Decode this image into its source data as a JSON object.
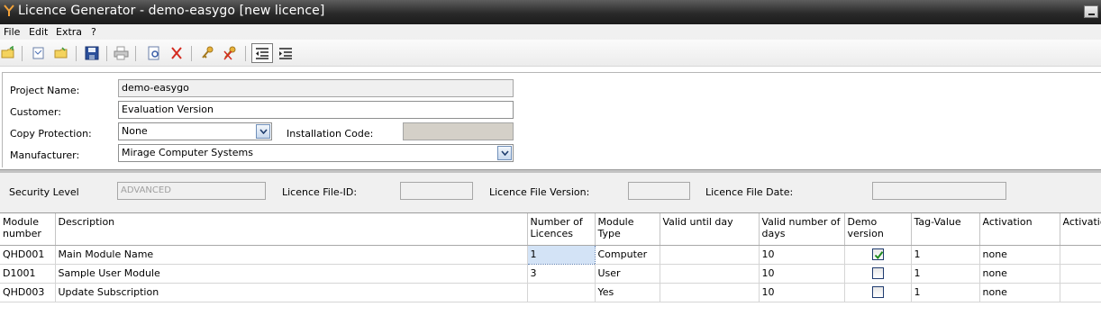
{
  "window": {
    "title": "Licence Generator - demo-easygo [new licence]"
  },
  "menu": [
    "File",
    "Edit",
    "Extra",
    "?"
  ],
  "toolbar": {
    "icons": [
      "open-folder-icon",
      "new-document-icon",
      "open-file-icon",
      "save-icon",
      "print-icon",
      "preview-icon",
      "delete-icon",
      "key-icon",
      "remove-key-icon",
      "indent-icon",
      "outdent-icon"
    ]
  },
  "form": {
    "project_name_label": "Project Name:",
    "project_name": "demo-easygo",
    "customer_label": "Customer:",
    "customer": "Evaluation Version",
    "copy_protection_label": "Copy Protection:",
    "copy_protection": "None",
    "installation_code_label": "Installation Code:",
    "installation_code": "",
    "manufacturer_label": "Manufacturer:",
    "manufacturer": "Mirage Computer Systems"
  },
  "security": {
    "level_label": "Security Level",
    "level": "ADVANCED",
    "file_id_label": "Licence File-ID:",
    "file_id": "",
    "file_version_label": "Licence File Version:",
    "file_version": "",
    "file_date_label": "Licence File Date:",
    "file_date": ""
  },
  "table": {
    "headers": [
      "Module number",
      "Description",
      "Number of Licences",
      "Module Type",
      "Valid until day",
      "Valid number of days",
      "Demo version",
      "Tag-Value",
      "Activation",
      "Activation"
    ],
    "rows": [
      {
        "module": "QHD001",
        "description": "Main Module Name",
        "licences": "1",
        "type": "Computer",
        "valid_until": "",
        "valid_days": "10",
        "demo": true,
        "tag": "1",
        "activation": "none",
        "more": "..."
      },
      {
        "module": "D1001",
        "description": "Sample User Module",
        "licences": "3",
        "type": "User",
        "valid_until": "",
        "valid_days": "10",
        "demo": false,
        "tag": "1",
        "activation": "none",
        "more": "..."
      },
      {
        "module": "QHD003",
        "description": "Update Subscription",
        "licences": "",
        "type": "Yes",
        "valid_until": "",
        "valid_days": "10",
        "demo": false,
        "tag": "1",
        "activation": "none",
        "more": "..."
      }
    ]
  }
}
